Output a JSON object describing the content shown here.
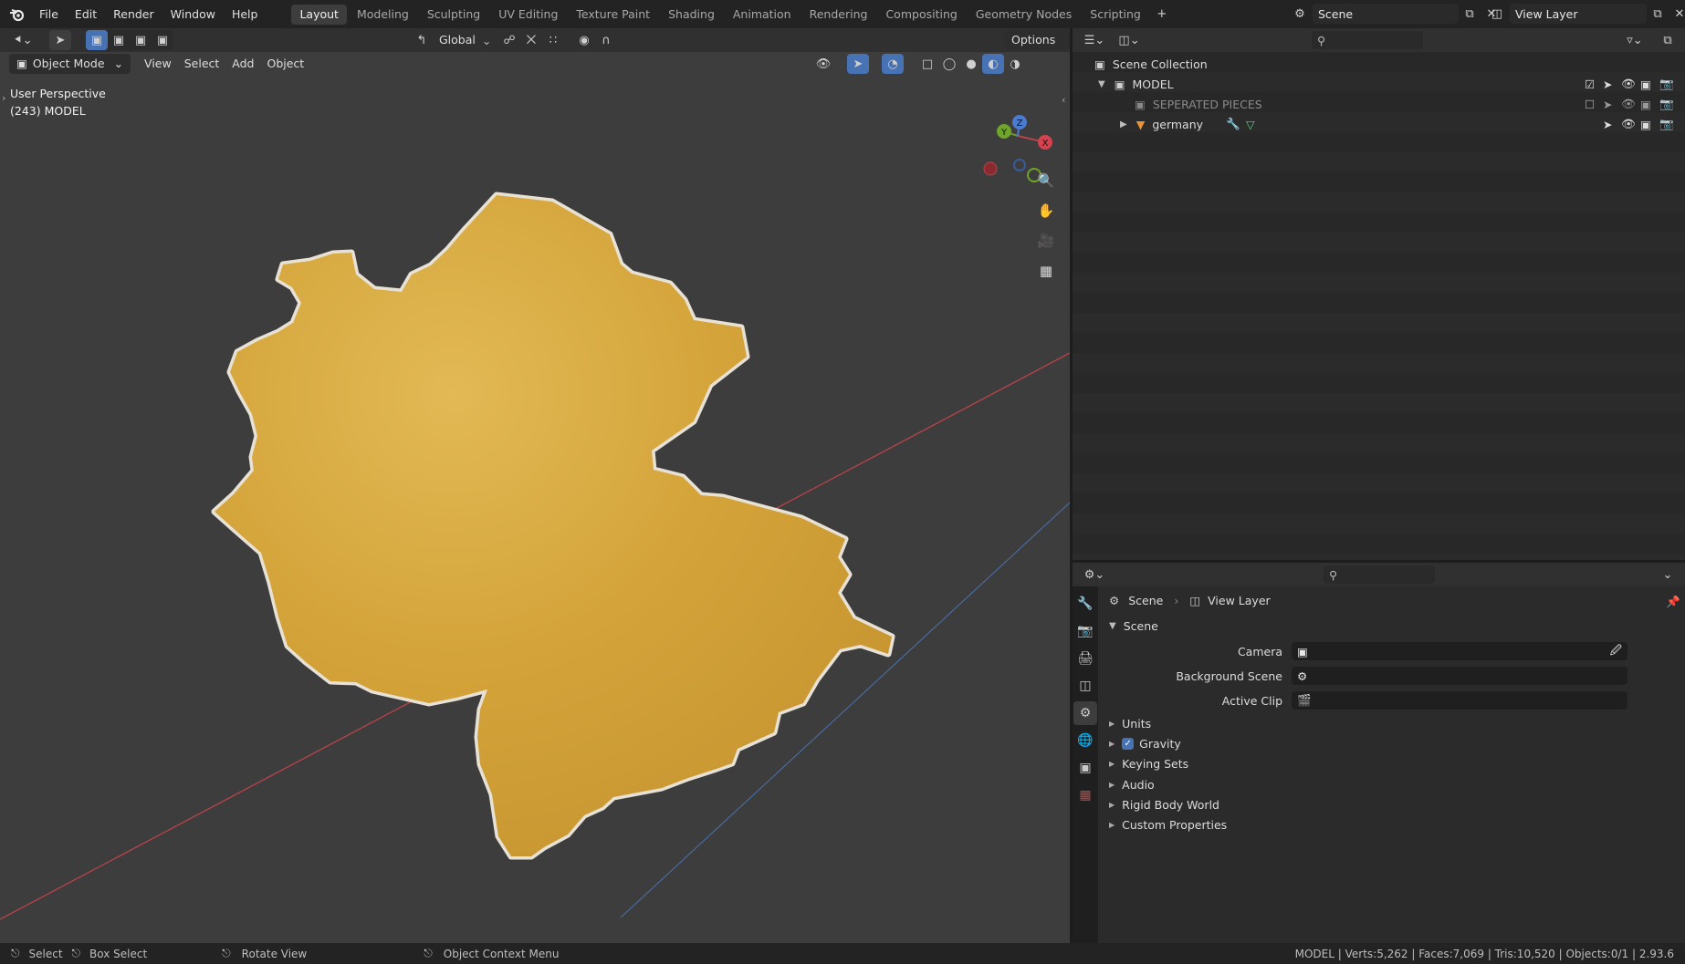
{
  "app": {
    "logo": "blender-logo-icon"
  },
  "menu": [
    "File",
    "Edit",
    "Render",
    "Window",
    "Help"
  ],
  "workspaces": [
    "Layout",
    "Modeling",
    "Sculpting",
    "UV Editing",
    "Texture Paint",
    "Shading",
    "Animation",
    "Rendering",
    "Compositing",
    "Geometry Nodes",
    "Scripting"
  ],
  "active_workspace": "Layout",
  "scene_field": "Scene",
  "view_layer_field": "View Layer",
  "viewport": {
    "transform_orientation": "Global",
    "options_label": "Options",
    "mode": "Object Mode",
    "header_menus": [
      "View",
      "Select",
      "Add",
      "Object"
    ],
    "overlay_line1": "User Perspective",
    "overlay_line2": "(243) MODEL",
    "gizmo_labels": {
      "y": "Y",
      "z": "Z",
      "x": "X"
    }
  },
  "outliner": {
    "root": "Scene Collection",
    "items": [
      {
        "name": "MODEL",
        "level": 1
      },
      {
        "name": "SEPERATED PIECES",
        "level": 2
      },
      {
        "name": "germany",
        "level": 2
      }
    ]
  },
  "properties": {
    "breadcrumb_scene": "Scene",
    "breadcrumb_layer": "View Layer",
    "panel_title": "Scene",
    "fields": [
      {
        "label": "Camera",
        "value": ""
      },
      {
        "label": "Background Scene",
        "value": ""
      },
      {
        "label": "Active Clip",
        "value": ""
      }
    ],
    "subpanels": [
      "Units",
      "Gravity",
      "Keying Sets",
      "Audio",
      "Rigid Body World",
      "Custom Properties"
    ],
    "gravity_checked": true
  },
  "status": {
    "select": "Select",
    "box_select": "Box Select",
    "rotate_view": "Rotate View",
    "context_menu": "Object Context Menu",
    "stats": "MODEL | Verts:5,262 | Faces:7,069 | Tris:10,520 | Objects:0/1 | 2.93.6"
  },
  "colors": {
    "map_fill": "#d8a83c",
    "map_outline": "#e8e2d6",
    "x_axis": "#b8434b",
    "y_axis": "#4a6ea6",
    "bg": "#3d3d3d"
  }
}
